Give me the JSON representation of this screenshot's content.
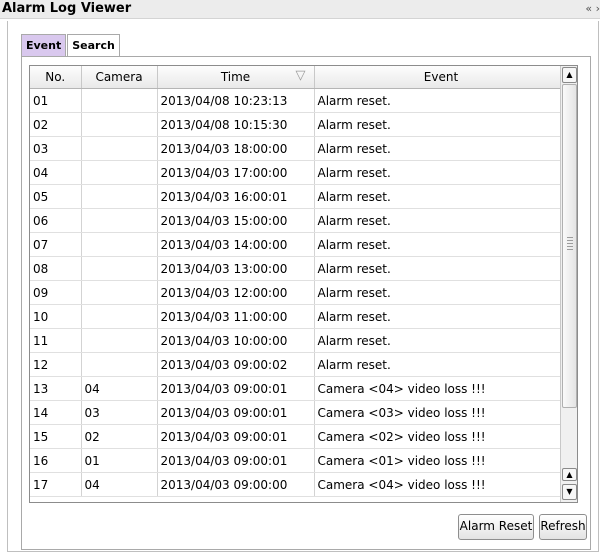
{
  "window": {
    "title": "Alarm Log Viewer",
    "collapse_glyph": "« ›"
  },
  "tabs": [
    {
      "label": "Event",
      "active": true
    },
    {
      "label": "Search",
      "active": false
    }
  ],
  "table": {
    "columns": [
      "No.",
      "Camera",
      "Time",
      "Event"
    ],
    "sort_icon": "sort-descending-icon",
    "rows": [
      [
        "01",
        "",
        "2013/04/08 10:23:13",
        "Alarm reset."
      ],
      [
        "02",
        "",
        "2013/04/08 10:15:30",
        "Alarm reset."
      ],
      [
        "03",
        "",
        "2013/04/03 18:00:00",
        "Alarm reset."
      ],
      [
        "04",
        "",
        "2013/04/03 17:00:00",
        "Alarm reset."
      ],
      [
        "05",
        "",
        "2013/04/03 16:00:01",
        "Alarm reset."
      ],
      [
        "06",
        "",
        "2013/04/03 15:00:00",
        "Alarm reset."
      ],
      [
        "07",
        "",
        "2013/04/03 14:00:00",
        "Alarm reset."
      ],
      [
        "08",
        "",
        "2013/04/03 13:00:00",
        "Alarm reset."
      ],
      [
        "09",
        "",
        "2013/04/03 12:00:00",
        "Alarm reset."
      ],
      [
        "10",
        "",
        "2013/04/03 11:00:00",
        "Alarm reset."
      ],
      [
        "11",
        "",
        "2013/04/03 10:00:00",
        "Alarm reset."
      ],
      [
        "12",
        "",
        "2013/04/03 09:00:02",
        "Alarm reset."
      ],
      [
        "13",
        "04",
        "2013/04/03 09:00:01",
        "Camera <04> video loss !!!"
      ],
      [
        "14",
        "03",
        "2013/04/03 09:00:01",
        "Camera <03> video loss !!!"
      ],
      [
        "15",
        "02",
        "2013/04/03 09:00:01",
        "Camera <02> video loss !!!"
      ],
      [
        "16",
        "01",
        "2013/04/03 09:00:01",
        "Camera <01> video loss !!!"
      ],
      [
        "17",
        "04",
        "2013/04/03 09:00:00",
        "Camera <04> video loss !!!"
      ]
    ]
  },
  "buttons": {
    "alarm_reset": "Alarm Reset",
    "refresh": "Refresh"
  },
  "colors": {
    "active_tab": "#d9c8ee",
    "header_bg": "#ececec"
  }
}
